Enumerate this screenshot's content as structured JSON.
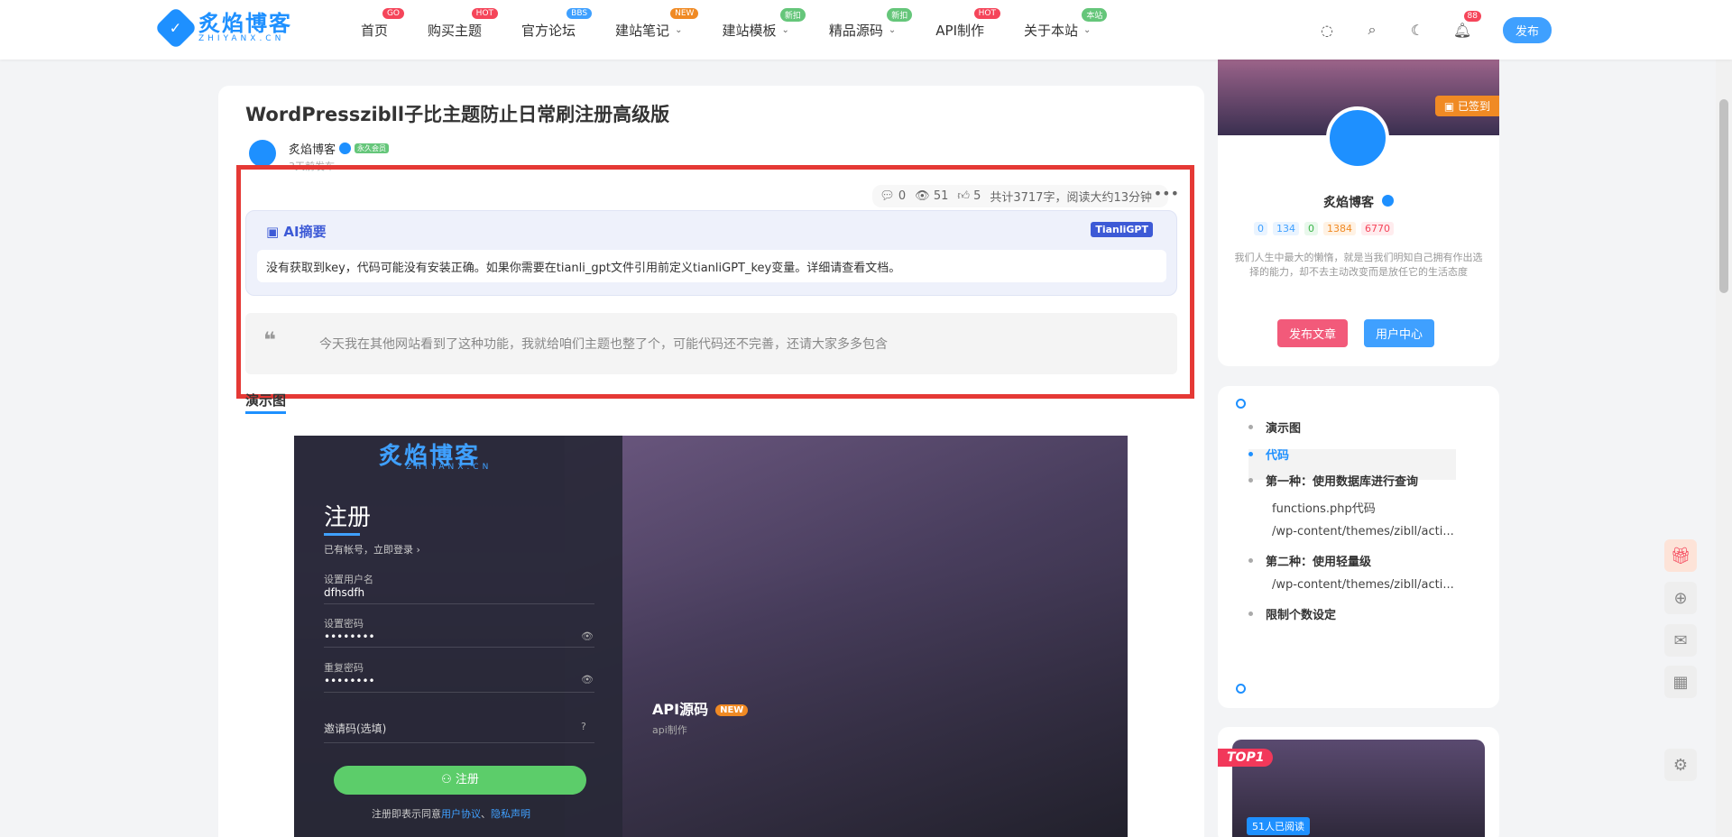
{
  "header": {
    "logo_text": "炙焰博客",
    "logo_sub": "ZHIYANX.CN",
    "nav": [
      {
        "label": "首页",
        "badge": "GO",
        "badge_color": "#f5455a",
        "dropdown": false
      },
      {
        "label": "购买主题",
        "badge": "HOT",
        "badge_color": "#f5455a",
        "dropdown": false
      },
      {
        "label": "官方论坛",
        "badge": "BBS",
        "badge_color": "#3fa0ff",
        "dropdown": false
      },
      {
        "label": "建站笔记",
        "badge": "NEW",
        "badge_color": "#f08a24",
        "dropdown": true
      },
      {
        "label": "建站模板",
        "badge": "新扣",
        "badge_color": "#65c67a",
        "dropdown": true
      },
      {
        "label": "精品源码",
        "badge": "新扣",
        "badge_color": "#65c67a",
        "dropdown": true
      },
      {
        "label": "API制作",
        "badge": "HOT",
        "badge_color": "#f5455a",
        "dropdown": false
      },
      {
        "label": "关于本站",
        "badge": "本站",
        "badge_color": "#65c67a",
        "dropdown": true
      }
    ],
    "notification_count": "88",
    "publish_label": "发布"
  },
  "article": {
    "title": "WordPresszibll子比主题防止日常刷注册高级版",
    "author_name": "炙焰博客",
    "vip_label": "永久会员",
    "post_time": "3天前发布",
    "comments": "0",
    "views": "51",
    "likes": "5",
    "word_info": "共计3717字，阅读大约13分钟",
    "ai_title": "AI摘要",
    "ai_badge": "TianliGPT",
    "ai_text": "没有获取到key，代码可能没有安装正确。如果你需要在tianli_gpt文件引用前定义tianliGPT_key变量。详细请查看文档。",
    "quote": "今天我在其他网站看到了这种功能，我就给咱们主题也整了个，可能代码还不完善，还请大家多多包含",
    "section_heading": "演示图"
  },
  "preview": {
    "logo": "炙焰博客",
    "logo_sub": "ZHIYANX.CN",
    "title": "注册",
    "login_link": "已有帐号，立即登录 ›",
    "username_label": "设置用户名",
    "username_value": "dfhsdfh",
    "password_label": "设置密码",
    "password_value": "••••••••",
    "repeat_label": "重复密码",
    "repeat_value": "••••••••",
    "invite_label": "邀请码(选填)",
    "register_button": "注册",
    "footer_prefix": "注册即表示同意",
    "footer_link1": "用户协议",
    "footer_sep": "、",
    "footer_link2": "隐私声明",
    "api_title": "API源码",
    "api_badge": "NEW",
    "api_sub": "api制作"
  },
  "profile": {
    "signed_label": "已签到",
    "name": "炙焰博客",
    "stats": [
      {
        "value": "0",
        "color": "#3fa0ff",
        "bg": "#eaf4ff"
      },
      {
        "value": "134",
        "color": "#3fa0ff",
        "bg": "#eaf4ff"
      },
      {
        "value": "0",
        "color": "#3bb54a",
        "bg": "#e9f8ec"
      },
      {
        "value": "1384",
        "color": "#f08a24",
        "bg": "#fff2e4"
      },
      {
        "value": "6770",
        "color": "#f5455a",
        "bg": "#ffecee"
      }
    ],
    "desc": "我们人生中最大的懒惰，就是当我们明知自己拥有作出选择的能力，却不去主动改变而是放任它的生活态度",
    "btn_publish": "发布文章",
    "btn_user": "用户中心"
  },
  "toc": {
    "items": [
      {
        "label": "演示图",
        "level": "main"
      },
      {
        "label": "代码",
        "level": "main"
      },
      {
        "label": "第一种：使用数据库进行查询",
        "level": "main"
      },
      {
        "label": "functions.php代码",
        "level": "sub"
      },
      {
        "label": "/wp-content/themes/zibll/acti...",
        "level": "sub"
      },
      {
        "label": "第二种：使用轻量级",
        "level": "main"
      },
      {
        "label": "/wp-content/themes/zibll/acti...",
        "level": "sub"
      },
      {
        "label": "限制个数设定",
        "level": "main"
      }
    ]
  },
  "top_card": {
    "tag": "TOP1",
    "read": "51人已阅读"
  }
}
